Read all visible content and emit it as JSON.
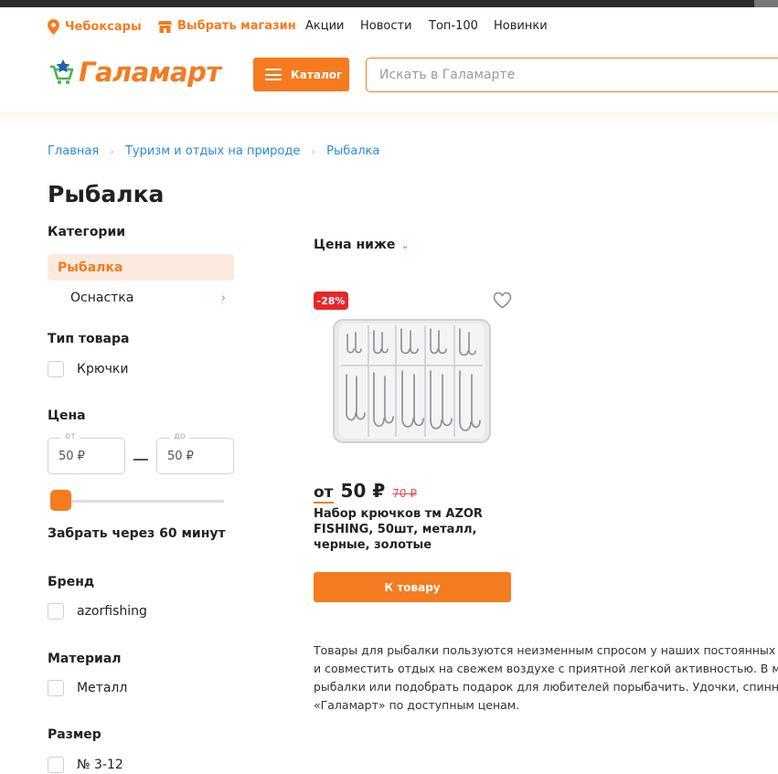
{
  "topnav": {
    "city": "Чебоксары",
    "store": "Выбрать магазин",
    "links": [
      "Акции",
      "Новости",
      "Топ-100",
      "Новинки"
    ]
  },
  "header": {
    "logo_text": "Галамарт",
    "catalog_label": "Каталог",
    "search_placeholder": "Искать в Галамарте"
  },
  "breadcrumb": [
    "Главная",
    "Туризм и отдых на природе",
    "Рыбалка"
  ],
  "page_title": "Рыбалка",
  "filters": {
    "categories_title": "Категории",
    "active_category": "Рыбалка",
    "subcategory": "Оснастка",
    "type_title": "Тип товара",
    "type_option": "Крючки",
    "price_title": "Цена",
    "price_from_label": "от",
    "price_to_label": "до",
    "price_from": "50 ₽",
    "price_to": "50 ₽",
    "pickup": "Забрать через 60 минут",
    "brand_title": "Бренд",
    "brand_option": "azorfishing",
    "material_title": "Материал",
    "material_option": "Металл",
    "size_title": "Размер",
    "size_option": "№ 3-12"
  },
  "sort_label": "Цена ниже",
  "product": {
    "discount": "-28%",
    "price_from": "от",
    "price": "50 ₽",
    "old_price": "70 ₽",
    "name": "Набор крючков тм AZOR FISHING, 50шт, металл, черные, золотые",
    "button": "К товару"
  },
  "seo_lines": [
    "Товары для рыбалки пользуются неизменным спросом у наших постоянных покупателей",
    "и совместить отдых на свежем воздухе с приятной легкой активностью. В магазинах",
    "рыбалки или подобрать подарок для любителей порыбачить. Удочки, спиннинги",
    "«Галамарт» по доступным ценам."
  ],
  "colors": {
    "accent": "#f47b20",
    "link": "#2a8bd8",
    "sale": "#e8262a"
  }
}
